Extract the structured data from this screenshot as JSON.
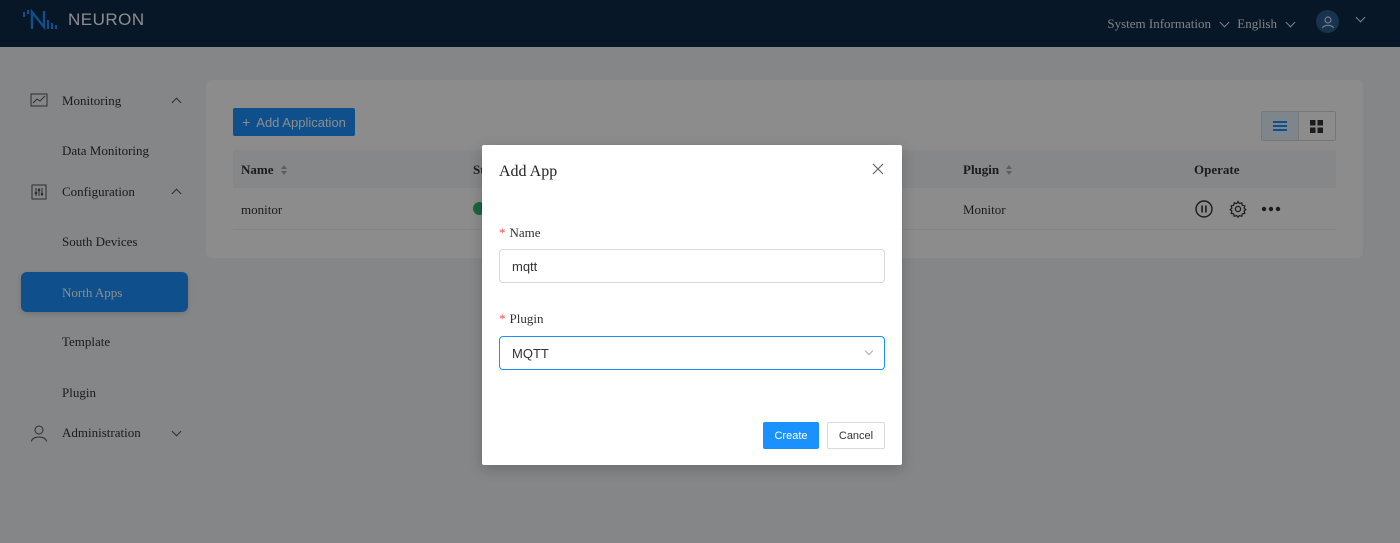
{
  "header": {
    "logo_text": "NEURON",
    "system_info_label": "System Information",
    "language_label": "English"
  },
  "sidebar": {
    "groups": [
      {
        "label": "Monitoring",
        "icon": "monitoring-icon",
        "expanded": true,
        "items": [
          {
            "label": "Data Monitoring"
          }
        ]
      },
      {
        "label": "Configuration",
        "icon": "configuration-icon",
        "expanded": true,
        "items": [
          {
            "label": "South Devices"
          },
          {
            "label": "North Apps",
            "active": true
          },
          {
            "label": "Template"
          },
          {
            "label": "Plugin"
          }
        ]
      },
      {
        "label": "Administration",
        "icon": "user-icon",
        "expanded": false,
        "items": []
      }
    ]
  },
  "main": {
    "add_button_label": "Add Application",
    "view_modes": [
      "list-icon",
      "grid-icon"
    ],
    "table": {
      "columns": {
        "name": "Name",
        "status": "St",
        "plugin": "Plugin",
        "operate": "Operate"
      },
      "rows": [
        {
          "name": "monitor",
          "status": "running",
          "plugin": "Monitor"
        }
      ]
    }
  },
  "modal": {
    "title": "Add App",
    "name_label": "Name",
    "name_value": "mqtt",
    "plugin_label": "Plugin",
    "plugin_value": "MQTT",
    "create_label": "Create",
    "cancel_label": "Cancel"
  },
  "colors": {
    "header_bg": "#0e2a47",
    "primary": "#1a91ff",
    "required": "#ff4d4f",
    "status_ok": "#2eb872"
  }
}
